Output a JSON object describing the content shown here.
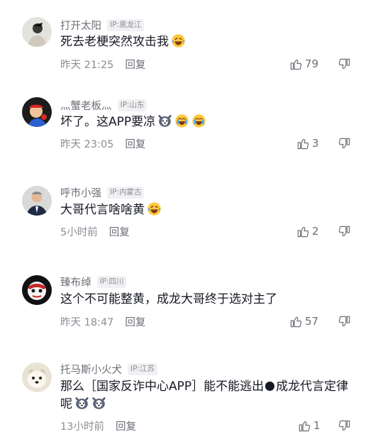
{
  "comments": [
    {
      "name": "打开太阳",
      "ip": "IP:黑龙江",
      "text": "死去老梗突然攻击我",
      "emojis": [
        "laugh-cry-emoji"
      ],
      "time": "昨天 21:25",
      "reply": "回复",
      "likes": "79"
    },
    {
      "name": "灬蟹老板灬",
      "ip": "IP:山东",
      "text": "坏了。这APP要凉",
      "emojis": [
        "husky-emoji",
        "laugh-tears-emoji",
        "laugh-tears-emoji"
      ],
      "time": "昨天 23:05",
      "reply": "回复",
      "likes": "3"
    },
    {
      "name": "呼市小强",
      "ip": "IP:内蒙古",
      "text": "大哥代言啥啥黄",
      "emojis": [
        "laugh-cry-emoji"
      ],
      "time": "5小时前",
      "reply": "回复",
      "likes": "2"
    },
    {
      "name": "臻布绰",
      "ip": "IP:四川",
      "text": "这个不可能整黄，成龙大哥终于选对主了",
      "emojis": [],
      "time": "昨天 18:47",
      "reply": "回复",
      "likes": "57"
    },
    {
      "name": "托马斯小火犬",
      "ip": "IP:江苏",
      "text_part1": "那么［国家反诈中心APP］能不能逃出",
      "text_part2": "成龙代言定律呢",
      "emojis": [
        "husky-emoji",
        "husky-emoji"
      ],
      "time": "13小时前",
      "reply": "回复",
      "likes": "1"
    }
  ],
  "icons": {
    "like": "thumbs-up-outline-icon",
    "dislike": "thumbs-down-outline-icon"
  },
  "colors": {
    "text": "#161823",
    "secondary": "#8a8d94",
    "ip_badge_bg": "#f1f1f3"
  }
}
